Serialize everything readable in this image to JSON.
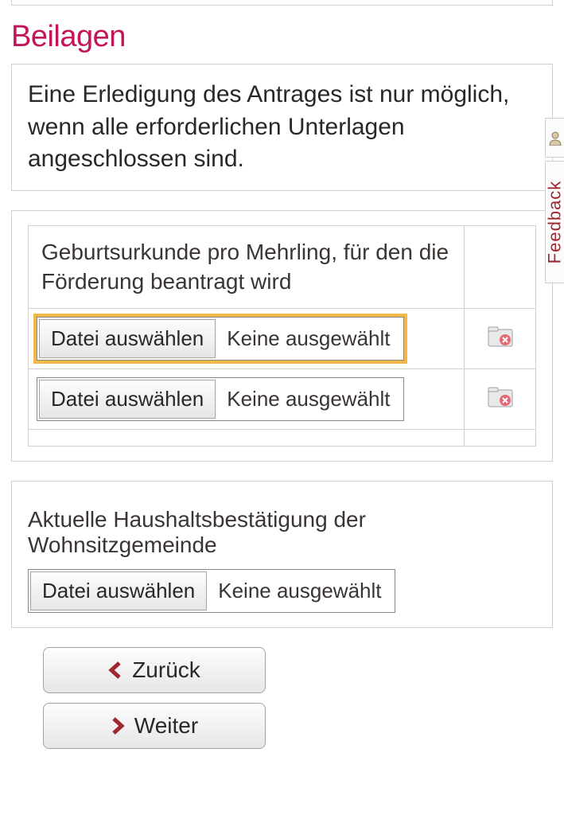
{
  "section_title": "Beilagen",
  "info_text": "Eine Erledigung des Antrages ist nur möglich, wenn alle erforderlichen Unterlagen angeschlossen sind.",
  "upload1": {
    "header": "Geburtsurkunde pro Mehrling, für den die Förderung beantragt wird",
    "rows": [
      {
        "button": "Datei auswählen",
        "status": "Keine ausgewählt",
        "highlight": true
      },
      {
        "button": "Datei auswählen",
        "status": "Keine ausgewählt",
        "highlight": false
      }
    ]
  },
  "upload2": {
    "header": "Aktuelle Haushaltsbestätigung der Wohnsitzgemeinde",
    "button": "Datei auswählen",
    "status": "Keine ausgewählt"
  },
  "nav": {
    "back": "Zurück",
    "next": "Weiter"
  },
  "side": {
    "feedback": "Feedback"
  }
}
